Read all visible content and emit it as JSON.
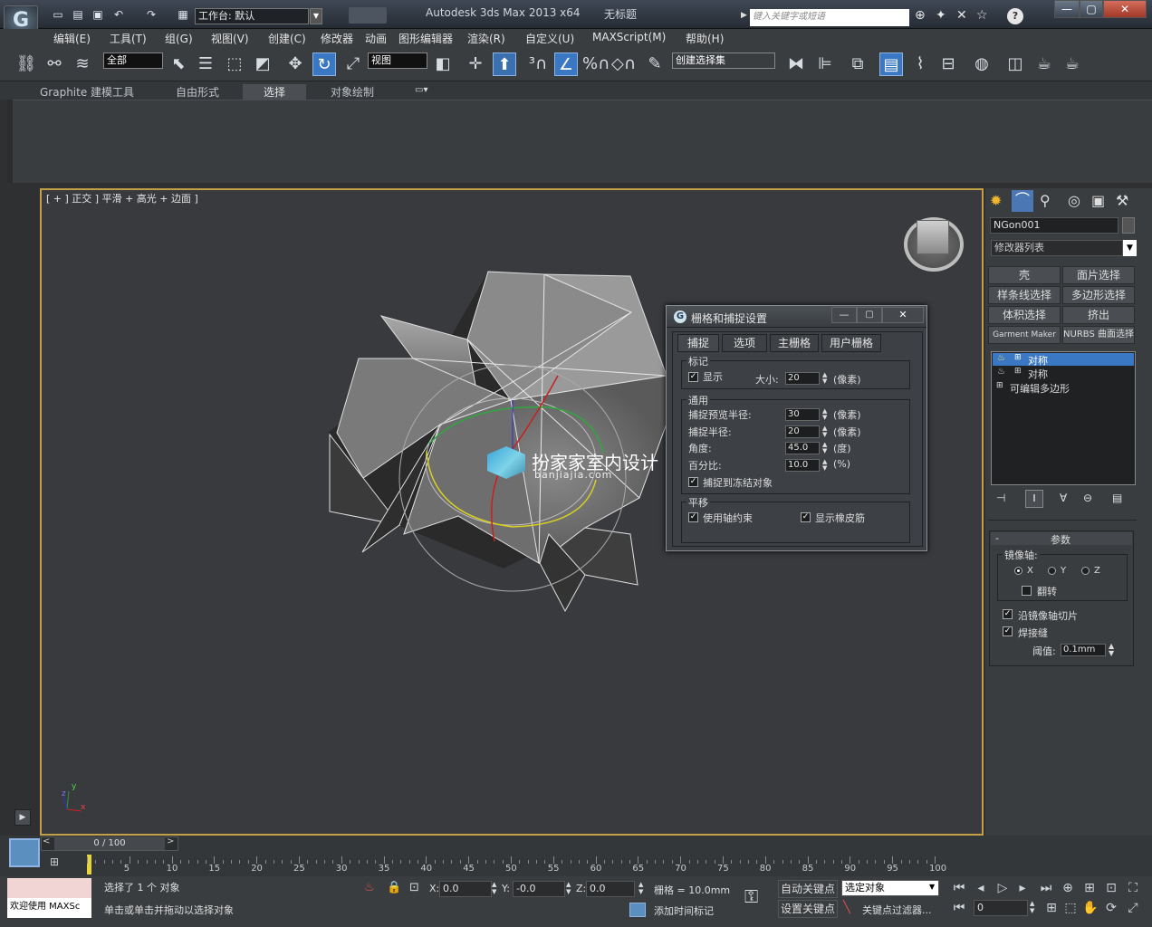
{
  "app": {
    "title": "Autodesk 3ds Max  2013 x64",
    "doc": "无标题",
    "workspace": "工作台: 默认",
    "search_placeholder": "键入关键字或短语"
  },
  "menus": [
    "编辑(E)",
    "工具(T)",
    "组(G)",
    "视图(V)",
    "创建(C)",
    "修改器",
    "动画",
    "图形编辑器",
    "渲染(R)",
    "自定义(U)",
    "MAXScript(M)",
    "帮助(H)"
  ],
  "toolbar": {
    "filter": "全部",
    "refcoord": "视图",
    "selset": "创建选择集"
  },
  "ribbon": {
    "tabs": [
      "Graphite 建模工具",
      "自由形式",
      "选择",
      "对象绘制"
    ]
  },
  "viewport": {
    "label": "[ + ] 正交 ] 平滑 + 高光 + 边面 ]",
    "watermark_title": "扮家家室内设计",
    "watermark_url": "banjiajia.com",
    "axis_x": "x",
    "axis_y": "y",
    "axis_z": "z"
  },
  "dialog": {
    "title": "栅格和捕捉设置",
    "tabs": [
      "捕捉",
      "选项",
      "主栅格",
      "用户栅格"
    ],
    "marker_group": "标记",
    "show": "显示",
    "size_label": "大小:",
    "size": "20",
    "px": "(像素)",
    "general_group": "通用",
    "preview_radius_label": "捕捉预览半径:",
    "preview_radius": "30",
    "snap_radius_label": "捕捉半径:",
    "snap_radius": "20",
    "angle_label": "角度:",
    "angle": "45.0",
    "deg": "(度)",
    "percent_label": "百分比:",
    "percent": "10.0",
    "pct": "(%)",
    "snap_frozen": "捕捉到冻结对象",
    "translate_group": "平移",
    "use_axis": "使用轴约束",
    "show_rubber": "显示橡皮筋"
  },
  "cmd": {
    "object_name": "NGon001",
    "modlist": "修改器列表",
    "buttons": [
      "壳",
      "面片选择",
      "样条线选择",
      "多边形选择",
      "体积选择",
      "挤出",
      "Garment Maker",
      "NURBS 曲面选择"
    ],
    "stack": [
      "对称",
      "对称",
      "可编辑多边形"
    ],
    "params_title": "参数",
    "mirror_axis": "镜像轴:",
    "x": "X",
    "y": "Y",
    "z": "Z",
    "flip": "翻转",
    "slice": "沿镜像轴切片",
    "weld": "焊接缝",
    "threshold_label": "阈值:",
    "threshold": "0.1mm"
  },
  "timeline": {
    "frame": "0 / 100",
    "ticks": [
      "5",
      "10",
      "15",
      "20",
      "25",
      "30",
      "35",
      "40",
      "45",
      "50",
      "55",
      "60",
      "65",
      "70",
      "75",
      "80",
      "85",
      "90",
      "95",
      "100"
    ]
  },
  "status": {
    "welcome": "欢迎使用 MAXSc",
    "selected": "选择了 1 个 对象",
    "prompt": "单击或单击并拖动以选择对象",
    "x_label": "X:",
    "x": "0.0",
    "y_label": "Y:",
    "y": "-0.0",
    "z_label": "Z:",
    "z": "0.0",
    "grid": "栅格 = 10.0mm",
    "add_time_tag": "添加时间标记",
    "auto_key": "自动关键点",
    "set_key": "设置关键点",
    "key_mode": "选定对象",
    "key_filter": "关键点过滤器...",
    "frame": "0"
  }
}
